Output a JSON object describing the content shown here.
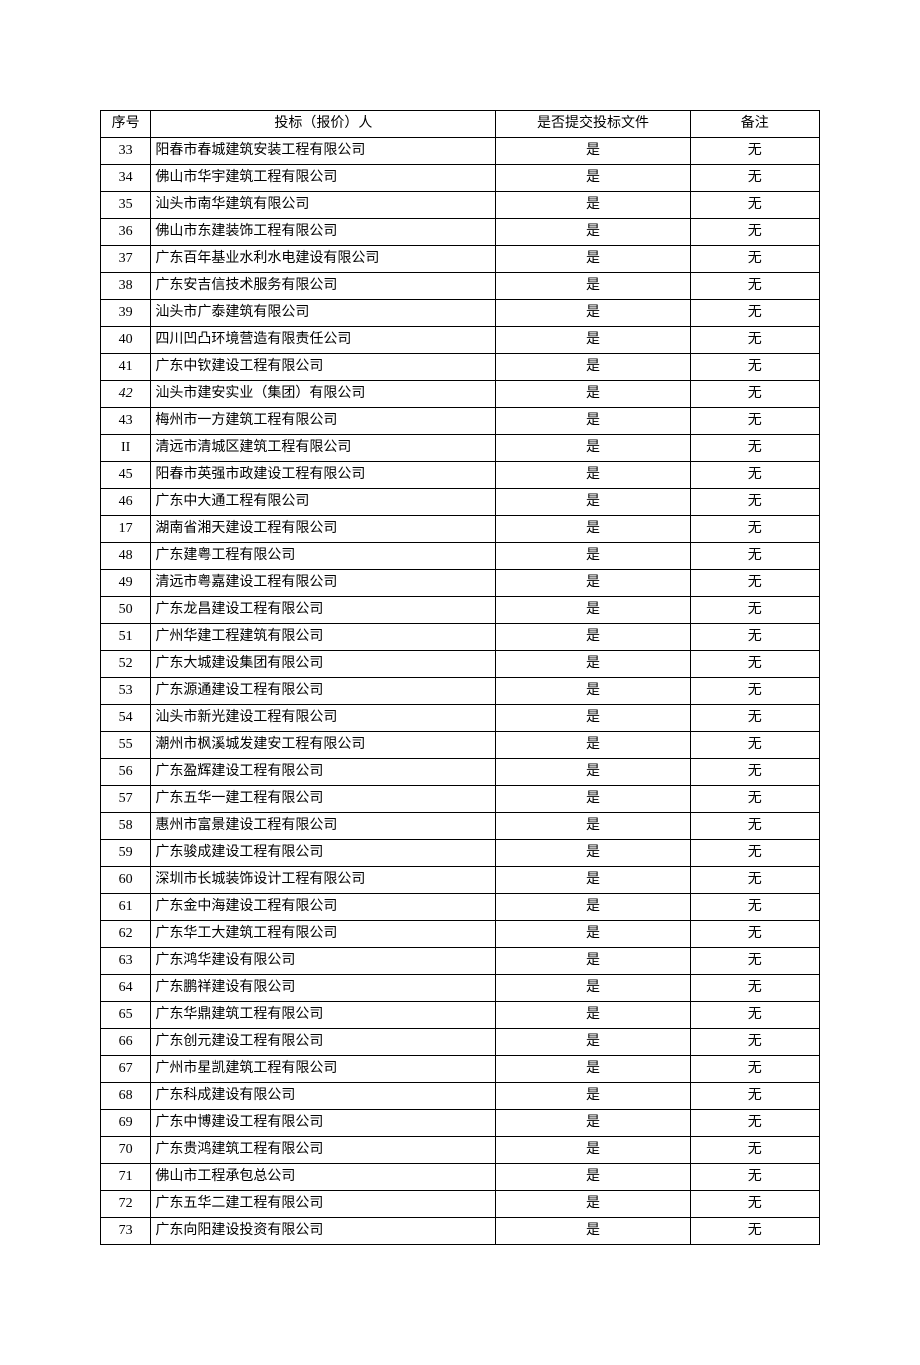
{
  "columns": {
    "seq": "序号",
    "bidder": "投标（报价）人",
    "submit": "是否提交投标文件",
    "note": "备注"
  },
  "rows": [
    {
      "seq": "33",
      "bidder": "阳春市春城建筑安装工程有限公司",
      "submit": "是",
      "note": "无"
    },
    {
      "seq": "34",
      "bidder": "佛山市华宇建筑工程有限公司",
      "submit": "是",
      "note": "无"
    },
    {
      "seq": "35",
      "bidder": "汕头市南华建筑有限公司",
      "submit": "是",
      "note": "无"
    },
    {
      "seq": "36",
      "bidder": "佛山市东建装饰工程有限公司",
      "submit": "是",
      "note": "无"
    },
    {
      "seq": "37",
      "bidder": "广东百年基业水利水电建设有限公司",
      "submit": "是",
      "note": "无"
    },
    {
      "seq": "38",
      "bidder": "广东安吉信技术服务有限公司",
      "submit": "是",
      "note": "无"
    },
    {
      "seq": "39",
      "bidder": "汕头市广泰建筑有限公司",
      "submit": "是",
      "note": "无"
    },
    {
      "seq": "40",
      "bidder": "四川凹凸环境营造有限责任公司",
      "submit": "是",
      "note": "无"
    },
    {
      "seq": "41",
      "bidder": "广东中钦建设工程有限公司",
      "submit": "是",
      "note": "无"
    },
    {
      "seq": "42",
      "seq_style": "italic",
      "bidder": "汕头市建安实业（集团）有限公司",
      "submit": "是",
      "note": "无"
    },
    {
      "seq": "43",
      "bidder": "梅州市一方建筑工程有限公司",
      "submit": "是",
      "note": "无"
    },
    {
      "seq": "II",
      "bidder": "清远市清城区建筑工程有限公司",
      "submit": "是",
      "note": "无"
    },
    {
      "seq": "45",
      "bidder": "阳春市英强市政建设工程有限公司",
      "submit": "是",
      "note": "无"
    },
    {
      "seq": "46",
      "bidder": "广东中大通工程有限公司",
      "submit": "是",
      "note": "无"
    },
    {
      "seq": "17",
      "bidder": "湖南省湘天建设工程有限公司",
      "submit": "是",
      "note": "无"
    },
    {
      "seq": "48",
      "bidder": "广东建粤工程有限公司",
      "submit": "是",
      "note": "无"
    },
    {
      "seq": "49",
      "bidder": "清远市粤嘉建设工程有限公司",
      "submit": "是",
      "note": "无"
    },
    {
      "seq": "50",
      "bidder": "广东龙昌建设工程有限公司",
      "submit": "是",
      "note": "无"
    },
    {
      "seq": "51",
      "bidder": "广州华建工程建筑有限公司",
      "submit": "是",
      "note": "无"
    },
    {
      "seq": "52",
      "bidder": "广东大城建设集团有限公司",
      "submit": "是",
      "note": "无"
    },
    {
      "seq": "53",
      "bidder": "广东源通建设工程有限公司",
      "submit": "是",
      "note": "无"
    },
    {
      "seq": "54",
      "bidder": "汕头市新光建设工程有限公司",
      "submit": "是",
      "note": "无"
    },
    {
      "seq": "55",
      "bidder": "潮州市枫溪城发建安工程有限公司",
      "submit": "是",
      "note": "无"
    },
    {
      "seq": "56",
      "bidder": "广东盈辉建设工程有限公司",
      "submit": "是",
      "note": "无"
    },
    {
      "seq": "57",
      "bidder": "广东五华一建工程有限公司",
      "submit": "是",
      "note": "无"
    },
    {
      "seq": "58",
      "bidder": "惠州市富景建设工程有限公司",
      "submit": "是",
      "note": "无"
    },
    {
      "seq": "59",
      "bidder": "广东骏成建设工程有限公司",
      "submit": "是",
      "note": "无"
    },
    {
      "seq": "60",
      "bidder": "深圳市长城装饰设计工程有限公司",
      "submit": "是",
      "note": "无"
    },
    {
      "seq": "61",
      "bidder": "广东金中海建设工程有限公司",
      "submit": "是",
      "note": "无"
    },
    {
      "seq": "62",
      "bidder": "广东华工大建筑工程有限公司",
      "submit": "是",
      "note": "无"
    },
    {
      "seq": "63",
      "bidder": "广东鸿华建设有限公司",
      "submit": "是",
      "note": "无"
    },
    {
      "seq": "64",
      "bidder": "广东鹏祥建设有限公司",
      "submit": "是",
      "note": "无"
    },
    {
      "seq": "65",
      "bidder": "广东华鼎建筑工程有限公司",
      "submit": "是",
      "note": "无"
    },
    {
      "seq": "66",
      "bidder": "广东创元建设工程有限公司",
      "submit": "是",
      "note": "无"
    },
    {
      "seq": "67",
      "bidder": "广州市星凯建筑工程有限公司",
      "submit": "是",
      "note": "无"
    },
    {
      "seq": "68",
      "bidder": "广东科成建设有限公司",
      "submit": "是",
      "note": "无"
    },
    {
      "seq": "69",
      "bidder": "广东中博建设工程有限公司",
      "submit": "是",
      "note": "无"
    },
    {
      "seq": "70",
      "bidder": "广东贵鸿建筑工程有限公司",
      "submit": "是",
      "note": "无"
    },
    {
      "seq": "71",
      "bidder": "佛山市工程承包总公司",
      "submit": "是",
      "note": "无"
    },
    {
      "seq": "72",
      "bidder": "广东五华二建工程有限公司",
      "submit": "是",
      "note": "无"
    },
    {
      "seq": "73",
      "bidder": "广东向阳建设投资有限公司",
      "submit": "是",
      "note": "无"
    }
  ]
}
